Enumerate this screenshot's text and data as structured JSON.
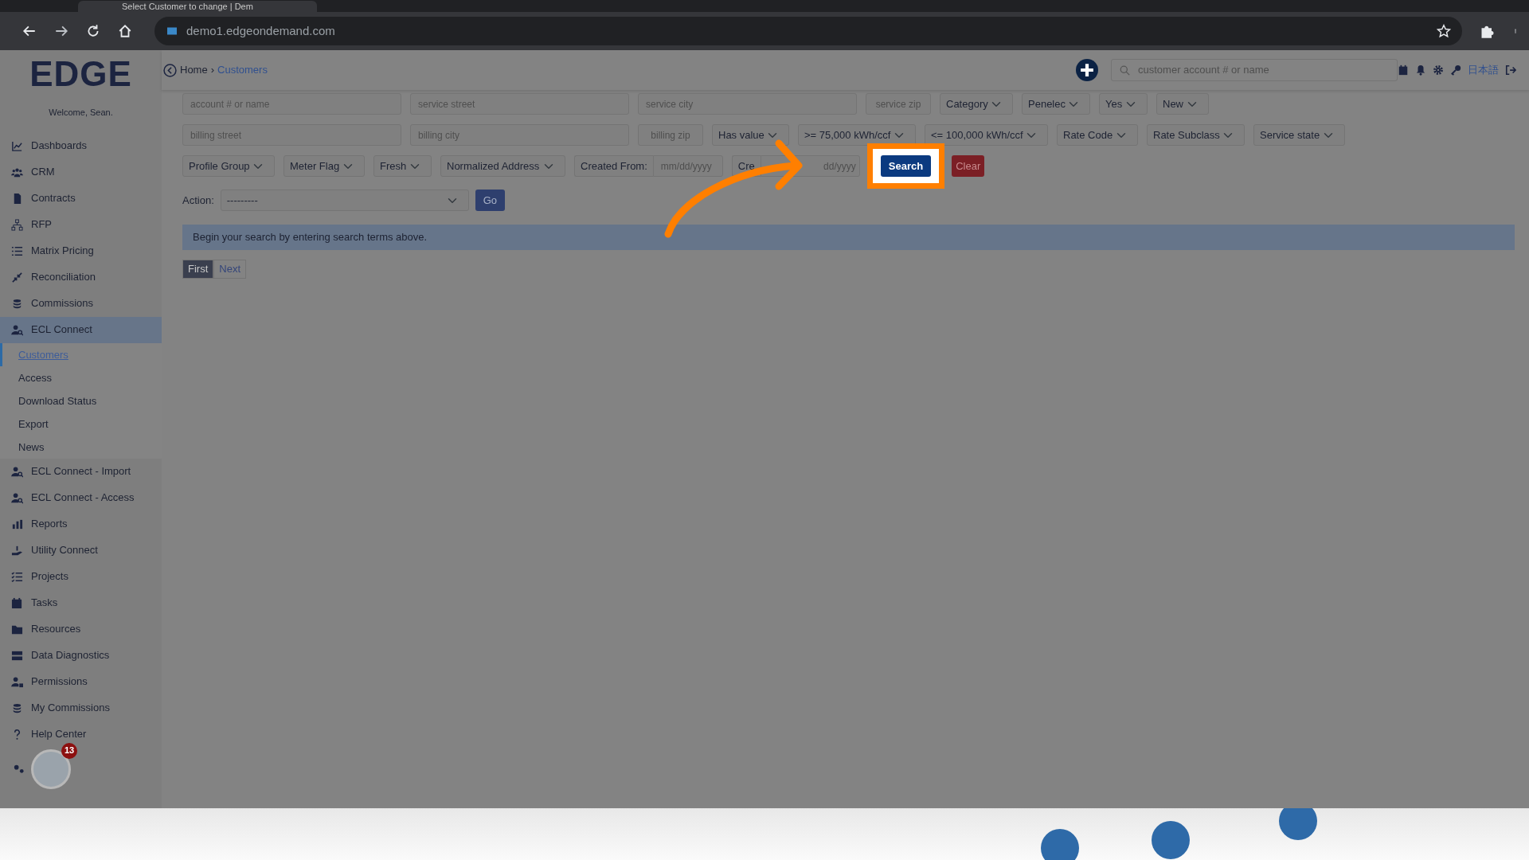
{
  "browser": {
    "tab_title": "Select Customer to change | Dem",
    "url": "demo1.edgeondemand.com"
  },
  "header": {
    "separator": "›",
    "breadcrumb": [
      {
        "label": "Home",
        "selected": false
      },
      {
        "label": "Customers",
        "selected": true
      }
    ],
    "search": {
      "placeholder": "customer account # or name"
    },
    "language": "日本語"
  },
  "sidebar": {
    "logo": "EDGE",
    "welcome": "Welcome, Sean.",
    "items": [
      {
        "label": "Dashboards",
        "selected": false
      },
      {
        "label": "CRM",
        "selected": false
      },
      {
        "label": "Contracts",
        "selected": false
      },
      {
        "label": "RFP",
        "selected": false
      },
      {
        "label": "Matrix Pricing",
        "selected": false
      },
      {
        "label": "Reconciliation",
        "selected": false
      },
      {
        "label": "Commissions",
        "selected": false
      },
      {
        "label": "ECL Connect",
        "selected": true,
        "children": [
          {
            "label": "Customers",
            "selected": true
          },
          {
            "label": "Access",
            "selected": false
          },
          {
            "label": "Download Status",
            "selected": false
          },
          {
            "label": "Export",
            "selected": false
          },
          {
            "label": "News",
            "selected": false
          }
        ]
      },
      {
        "label": "ECL Connect - Import",
        "selected": false
      },
      {
        "label": "ECL Connect - Access",
        "selected": false
      },
      {
        "label": "Reports",
        "selected": false
      },
      {
        "label": "Utility Connect",
        "selected": false
      },
      {
        "label": "Projects",
        "selected": false
      },
      {
        "label": "Tasks",
        "selected": false
      },
      {
        "label": "Resources",
        "selected": false
      },
      {
        "label": "Data Diagnostics",
        "selected": false
      },
      {
        "label": "Permissions",
        "selected": false
      },
      {
        "label": "My Commissions",
        "selected": false
      },
      {
        "label": "Help Center",
        "selected": false
      }
    ],
    "help_badge": "13"
  },
  "filters": [
    [
      {
        "kind": "text",
        "placeholder": "account # or name"
      },
      {
        "kind": "text",
        "placeholder": "service street"
      },
      {
        "kind": "text",
        "placeholder": "service city"
      },
      {
        "kind": "zip",
        "placeholder": "service zip"
      },
      {
        "kind": "select",
        "value": "Category"
      },
      {
        "kind": "select",
        "value": "Penelec"
      },
      {
        "kind": "select",
        "value": "Yes"
      },
      {
        "kind": "select",
        "value": "New"
      }
    ],
    [
      {
        "kind": "text",
        "placeholder": "billing street"
      },
      {
        "kind": "text",
        "placeholder": "billing city"
      },
      {
        "kind": "zip",
        "placeholder": "billing zip"
      },
      {
        "kind": "select",
        "value": "Has value"
      },
      {
        "kind": "select",
        "value": ">= 75,000 kWh/ccf"
      },
      {
        "kind": "select",
        "value": "<= 100,000 kWh/ccf"
      },
      {
        "kind": "select",
        "value": "Rate Code"
      },
      {
        "kind": "select",
        "value": "Rate Subclass"
      },
      {
        "kind": "select",
        "value": "Service state"
      }
    ],
    [
      {
        "kind": "select",
        "value": "Profile Group"
      },
      {
        "kind": "select",
        "value": "Meter Flag"
      },
      {
        "kind": "select",
        "value": "Fresh"
      },
      {
        "kind": "select",
        "value": "Normalized Address"
      },
      {
        "kind": "date",
        "label": "Created From:",
        "placeholder": "mm/dd/yyyy"
      },
      {
        "kind": "date",
        "label": "Cre",
        "placeholder": "dd/yyyy"
      },
      {
        "kind": "submit",
        "label": "Search",
        "highlighted": true
      },
      {
        "kind": "reset",
        "label": "Clear",
        "highlighted": false
      }
    ]
  ],
  "action": {
    "label": "Action:",
    "value": "---------",
    "button": "Go"
  },
  "alert": "Begin your search by entering search terms above.",
  "pagination": [
    {
      "label": "First",
      "selected": true
    },
    {
      "label": "Next",
      "selected": false
    }
  ]
}
